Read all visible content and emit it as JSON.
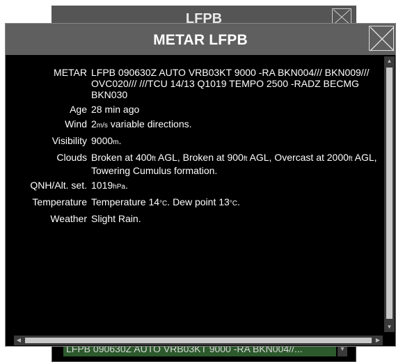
{
  "background_window": {
    "title": "LFPB",
    "metar_preview": "LFPB 090630Z AUTO VRB03KT 9000 -RA BKN004//..."
  },
  "dialog": {
    "title": "METAR LFPB",
    "rows": [
      {
        "label": "METAR",
        "parts": [
          {
            "t": "LFPB 090630Z AUTO VRB03KT 9000 -RA BKN004/// BKN009/// OVC020/// ///TCU 14/13 Q1019 TEMPO 2500 -RADZ BECMG BKN030"
          }
        ]
      },
      {
        "label": "Age",
        "parts": [
          {
            "t": "28 min ago"
          }
        ]
      },
      {
        "label": "Wind",
        "parts": [
          {
            "t": "2"
          },
          {
            "t": "m/s",
            "u": true
          },
          {
            "t": " variable directions."
          }
        ]
      },
      {
        "label": "Visibility",
        "parts": [
          {
            "t": "9000"
          },
          {
            "t": "m",
            "u": true
          },
          {
            "t": "."
          }
        ]
      },
      {
        "label": "Clouds",
        "parts": [
          {
            "t": "Broken at 400"
          },
          {
            "t": "ft",
            "u": true
          },
          {
            "t": " AGL, Broken at 900"
          },
          {
            "t": "ft",
            "u": true
          },
          {
            "t": " AGL, Overcast at 2000"
          },
          {
            "t": "ft",
            "u": true
          },
          {
            "t": " AGL, Towering Cumulus formation."
          }
        ]
      },
      {
        "label": "QNH/Alt. set.",
        "parts": [
          {
            "t": "1019"
          },
          {
            "t": "hPa",
            "u": true
          },
          {
            "t": "."
          }
        ]
      },
      {
        "label": "Temperature",
        "parts": [
          {
            "t": "Temperature 14"
          },
          {
            "t": "°C",
            "u": true
          },
          {
            "t": ". Dew point 13"
          },
          {
            "t": "°C",
            "u": true
          },
          {
            "t": "."
          }
        ]
      },
      {
        "label": "Weather",
        "parts": [
          {
            "t": "Slight Rain."
          }
        ]
      }
    ]
  },
  "colors": {
    "title_bar": "#5f5f5f",
    "content_bg": "#000000",
    "text": "#ffffff",
    "background_metar_bar": "#2d5a2d"
  },
  "icons": {
    "close": "close-icon",
    "scroll_up": "scroll-up-arrow-icon",
    "scroll_down": "scroll-down-arrow-icon",
    "scroll_left": "scroll-left-arrow-icon",
    "scroll_right": "scroll-right-arrow-icon"
  }
}
